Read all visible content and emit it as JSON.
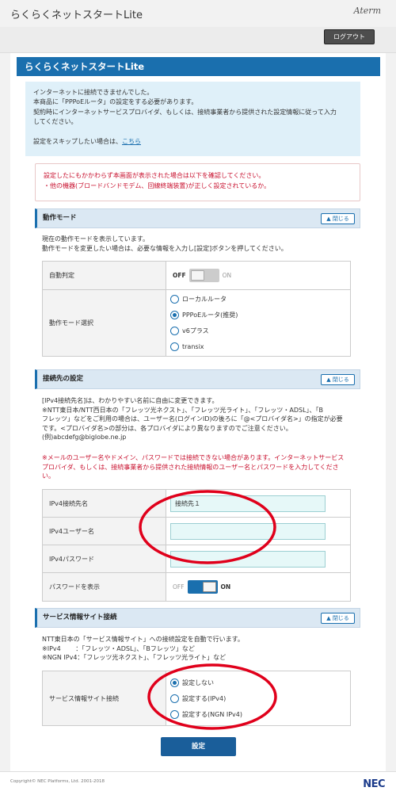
{
  "app_title": "らくらくネットスタートLite",
  "brand": "Aterm",
  "logout_label": "ログアウト",
  "page_heading": "らくらくネットスタートLite",
  "info": {
    "line1": "インターネットに接続できませんでした。",
    "line2": "本商品に「PPPoEルータ」の設定をする必要があります。",
    "line3": "契約時にインターネットサービスプロバイダ、もしくは、接続事業者から提供された設定情報に従って入力",
    "line4": "してください。",
    "skip_text": "設定をスキップしたい場合は、",
    "skip_link": "こちら"
  },
  "warning": {
    "line1": "設定したにもかかわらず本画面が表示された場合は以下を確認してください。",
    "line2": "・他の機器(ブロードバンドモデム、回線終端装置)が正しく設定されているか。"
  },
  "collapse_label": "閉じる",
  "mode_section": {
    "title": "動作モード",
    "desc1": "現在の動作モードを表示しています。",
    "desc2": "動作モードを変更したい場合は、必要な情報を入力し[設定]ボタンを押してください。",
    "auto_label": "自動判定",
    "auto_off": "OFF",
    "auto_on": "ON",
    "select_label": "動作モード選択",
    "options": [
      "ローカルルータ",
      "PPPoEルータ(推奨)",
      "v6プラス",
      "transix"
    ],
    "selected_index": 1
  },
  "conn_section": {
    "title": "接続先の設定",
    "desc1": "[IPv4接続先名]は、わかりやすい名前に自由に変更できます。",
    "desc2": "※NTT東日本/NTT西日本の「フレッツ光ネクスト」、「フレッツ光ライト」、「フレッツ・ADSL」、「B",
    "desc3": "フレッツ」などをご利用の場合は、ユーザー名(ログインID)の後ろに「@<プロバイダ名>」の指定が必要",
    "desc4": "です。<プロバイダ名>の部分は、各プロバイダにより異なりますのでご注意ください。",
    "desc5": "(例)abcdefg@biglobe.ne.jp",
    "warn1": "※メールのユーザー名やドメイン、パスワードでは接続できない場合があります。インターネットサービス",
    "warn2": "プロバイダ、もしくは、接続事業者から提供された接続情報のユーザー名とパスワードを入力してくださ",
    "warn3": "い。",
    "name_label": "IPv4接続先名",
    "name_value": "接続先１",
    "user_label": "IPv4ユーザー名",
    "user_value": "",
    "pass_label": "IPv4パスワード",
    "pass_value": "",
    "show_pass_label": "パスワードを表示",
    "show_off": "OFF",
    "show_on": "ON"
  },
  "service_section": {
    "title": "サービス情報サイト接続",
    "desc1": "NTT東日本の「サービス情報サイト」への接続設定を自動で行います。",
    "desc2": "※IPv4　　 ：「フレッツ・ADSL」、「Bフレッツ」など",
    "desc3": "※NGN IPv4：「フレッツ光ネクスト」、「フレッツ光ライト」など",
    "label": "サービス情報サイト接続",
    "options": [
      "設定しない",
      "設定する(IPv4)",
      "設定する(NGN IPv4)"
    ],
    "selected_index": 0
  },
  "submit_label": "設定",
  "footer": {
    "copyright": "Copyright© NEC Platforms, Ltd. 2001-2018",
    "logo": "NEC"
  },
  "colors": {
    "accent": "#1a6fae",
    "warning": "#c8102e",
    "annotation": "#e0001b"
  }
}
